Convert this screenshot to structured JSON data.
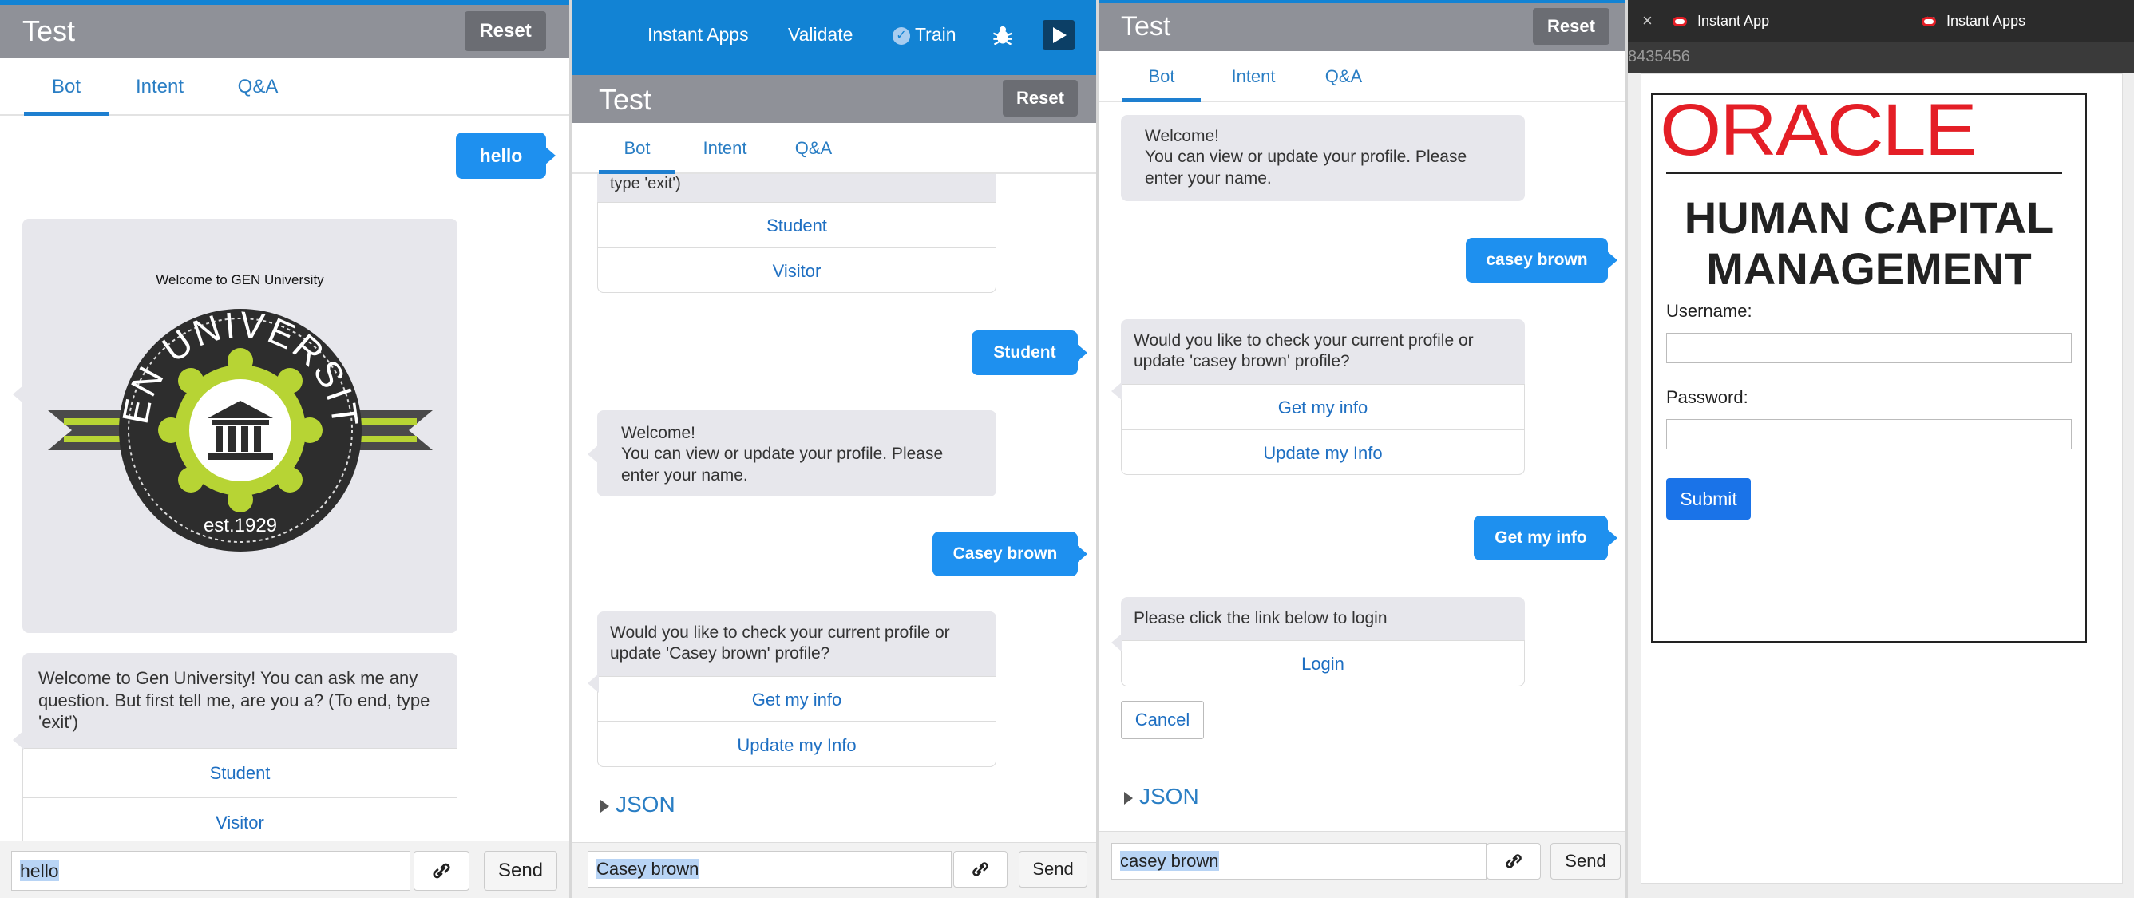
{
  "colors": {
    "accent": "#1e90ef",
    "header_gray": "#8f9198",
    "top_blue": "#1283d4",
    "oracle_red": "#e41e26"
  },
  "panel1": {
    "title": "Test",
    "reset": "Reset",
    "tabs": [
      "Bot",
      "Intent",
      "Q&A"
    ],
    "user_msg": "hello",
    "card_welcome": "Welcome to GEN University",
    "badge_top": "GEN UNIVERSITY",
    "badge_bottom": "est.1929",
    "bot_msg": "Welcome to Gen University! You can ask me any question. But first tell me, are you a? (To end, type 'exit')",
    "actions": [
      "Student",
      "Visitor"
    ],
    "input_value": "hello",
    "send": "Send"
  },
  "panel2": {
    "topbar": {
      "instant_apps": "Instant Apps",
      "validate": "Validate",
      "train": "Train"
    },
    "title": "Test",
    "reset": "Reset",
    "tabs": [
      "Bot",
      "Intent",
      "Q&A"
    ],
    "cut_text": "type 'exit')",
    "actions_top": [
      "Student",
      "Visitor"
    ],
    "user_msg1": "Student",
    "bot_msg1": "Welcome!\nYou can view or update your profile. Please enter your name.",
    "user_msg2": "Casey brown",
    "bot_msg2": "Would you like to check your current profile or update 'Casey brown' profile?",
    "actions_bottom": [
      "Get my info",
      "Update my Info"
    ],
    "json_label": "JSON",
    "input_value": "Casey brown",
    "send": "Send"
  },
  "panel3": {
    "title": "Test",
    "reset": "Reset",
    "tabs": [
      "Bot",
      "Intent",
      "Q&A"
    ],
    "bot_msg1": "Welcome!\nYou can view or update your profile. Please enter your name.",
    "user_msg1": "casey brown",
    "bot_msg2": "Would you like to check your current profile or update 'casey brown' profile?",
    "actions": [
      "Get my info",
      "Update my Info"
    ],
    "user_msg2": "Get my info",
    "bot_msg3": "Please click the link below to login",
    "login": "Login",
    "cancel": "Cancel",
    "json_label": "JSON",
    "input_value": "casey brown",
    "send": "Send"
  },
  "panel4": {
    "tabs": [
      {
        "label": "Instant App",
        "close": "×"
      },
      {
        "label": "Instant Apps"
      }
    ],
    "tab_close_left": "×",
    "url_fragment": "8435456",
    "oracle_logo": "ORACLE",
    "hcm_line1": "HUMAN CAPITAL",
    "hcm_line2": "MANAGEMENT",
    "username_label": "Username:",
    "password_label": "Password:",
    "submit": "Submit"
  }
}
